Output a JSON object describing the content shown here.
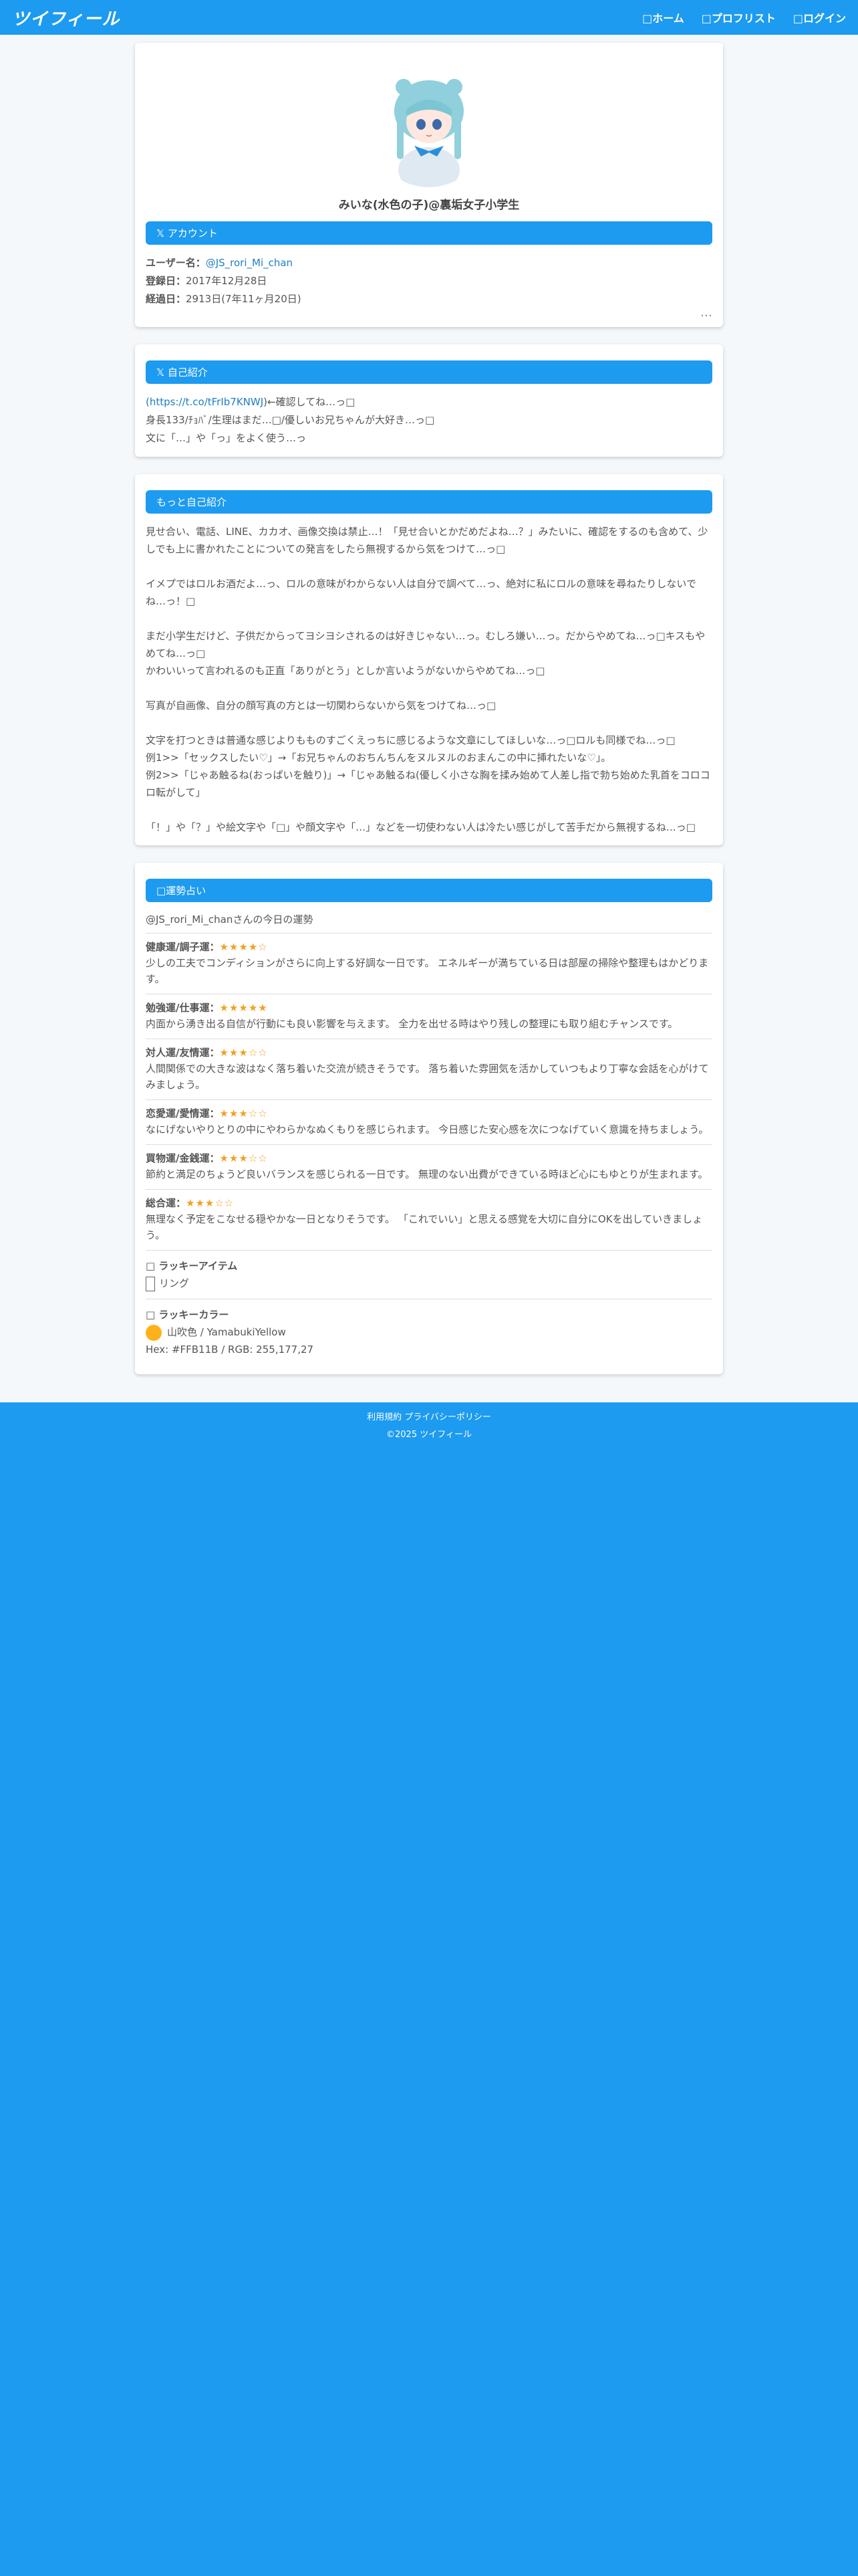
{
  "header": {
    "logo": "ツイフィール",
    "nav": [
      "□ホーム",
      "□プロフリスト",
      "□ログイン"
    ]
  },
  "profile": {
    "display_name": "みいな(水色の子)@裏垢女子小学生",
    "account_section": "𝕏 アカウント",
    "username_label": "ユーザー名：",
    "username": "@JS_rori_Mi_chan",
    "registered_label": "登録日：",
    "registered": "2017年12月28日",
    "elapsed_label": "経過日：",
    "elapsed": "2913日(7年11ヶ月20日)",
    "more": "…"
  },
  "bio": {
    "section": "𝕏 自己紹介",
    "link": "(https://t.co/tFrIb7KNWJ",
    "after_link": ")←確認してね…っ□",
    "lines": [
      "身長133/ﾁｮﾊﾞ/生理はまだ…□/優しいお兄ちゃんが大好き…っ□",
      "文に「…」や「っ」をよく使う…っ"
    ]
  },
  "more_bio": {
    "section": "もっと自己紹介",
    "text": "見せ合い、電話、LINE、カカオ、画像交換は禁止…！「見せ合いとかだめだよね…？」みたいに、確認をするのも含めて、少しでも上に書かれたことについての発言をしたら無視するから気をつけて…っ□\n\nイメプではロルお酒だよ…っ、ロルの意味がわからない人は自分で調べて…っ、絶対に私にロルの意味を尋ねたりしないでね…っ！□\n\nまだ小学生だけど、子供だからってヨシヨシされるのは好きじゃない…っ。むしろ嫌い…っ。だからやめてね…っ□キスもやめてね…っ□\nかわいいって言われるのも正直「ありがとう」としか言いようがないからやめてね…っ□\n\n写真が自画像、自分の顔写真の方とは一切関わらないから気をつけてね…っ□\n\n文字を打つときは普通な感じよりもものすごくえっちに感じるような文章にしてほしいな…っ□ロルも同様でね…っ□\n例1>>「セックスしたい♡」→「お兄ちゃんのおちんちんをヌルヌルのおまんこの中に挿れたいな♡」。\n例2>>「じゃあ触るね(おっぱいを触り)」→「じゃあ触るね(優しく小さな胸を揉み始めて人差し指で勃ち始めた乳首をコロコロ転がして」\n\n「！」や「？」や絵文字や「□」や顔文字や「…」などを一切使わない人は冷たい感じがして苦手だから無視するね…っ□"
  },
  "fortune": {
    "section": "□運勢占い",
    "intro": "@JS_rori_Mi_chanさんの今日の運勢",
    "items": [
      {
        "title": "健康運/調子運：",
        "stars": "★★★★☆",
        "text": "少しの工夫でコンディションがさらに向上する好調な一日です。 エネルギーが満ちている日は部屋の掃除や整理もはかどります。"
      },
      {
        "title": "勉強運/仕事運：",
        "stars": "★★★★★",
        "text": "内面から湧き出る自信が行動にも良い影響を与えます。 全力を出せる時はやり残しの整理にも取り組むチャンスです。"
      },
      {
        "title": "対人運/友情運：",
        "stars": "★★★☆☆",
        "text": "人間関係での大きな波はなく落ち着いた交流が続きそうです。 落ち着いた雰囲気を活かしていつもより丁寧な会話を心がけてみましょう。"
      },
      {
        "title": "恋愛運/愛情運：",
        "stars": "★★★☆☆",
        "text": "なにげないやりとりの中にやわらかなぬくもりを感じられます。 今日感じた安心感を次につなげていく意識を持ちましょう。"
      },
      {
        "title": "買物運/金銭運：",
        "stars": "★★★☆☆",
        "text": "節約と満足のちょうど良いバランスを感じられる一日です。 無理のない出費ができている時ほど心にもゆとりが生まれます。"
      },
      {
        "title": "総合運：",
        "stars": "★★★☆☆",
        "text": "無理なく予定をこなせる穏やかな一日となりそうです。 「これでいい」と思える感覚を大切に自分にOKを出していきましょう。"
      }
    ],
    "lucky_item_label": "□ ラッキーアイテム",
    "lucky_item": "リング",
    "lucky_color_label": "□ ラッキーカラー",
    "lucky_color_name": "山吹色 / YamabukiYellow",
    "lucky_color_codes": "Hex: #FFB11B / RGB: 255,177,27",
    "lucky_color_hex": "#FFB11B"
  },
  "footer": {
    "links": "利用規約 プライバシーポリシー",
    "copyright": "©2025 ツイフィール"
  },
  "colors": {
    "accent": "#1d9bf0",
    "star": "#f0a020"
  }
}
